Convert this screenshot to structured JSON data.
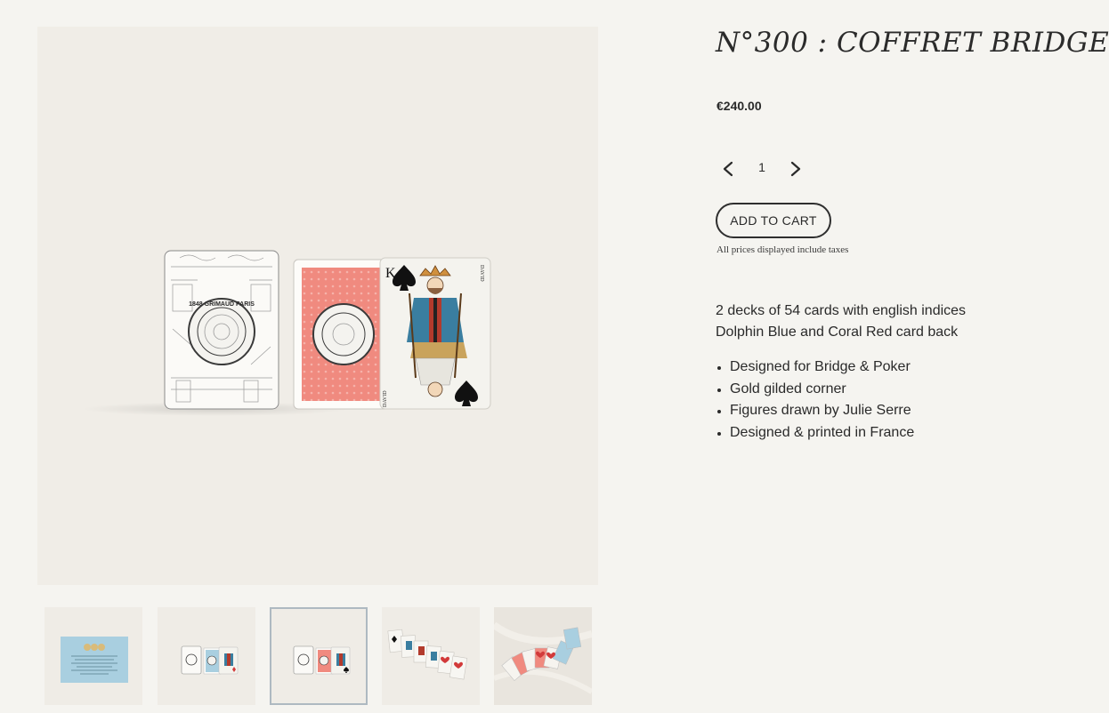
{
  "product": {
    "title": "N°300 : COFFRET BRIDGE",
    "price": "€240.00",
    "quantity": "1",
    "add_to_cart_label": "ADD TO CART",
    "tax_note": "All prices displayed include taxes"
  },
  "description": {
    "lines": [
      "2 decks of 54 cards with english indices",
      "Dolphin Blue and Coral Red card back"
    ],
    "features": [
      "Designed for Bridge & Poker",
      "Gold gilded corner",
      "Figures drawn by Julie Serre",
      "Designed & printed in France"
    ]
  },
  "gallery": {
    "seal_text": "1848 GRIMAUD PARIS",
    "card_name": "DAVID",
    "card_rank": "K",
    "selected_index": 2,
    "thumbnails": [
      {
        "content": "blue box lid"
      },
      {
        "content": "box with blue deck"
      },
      {
        "content": "box with coral deck"
      },
      {
        "content": "fanned cards"
      },
      {
        "content": "spread of cards"
      }
    ]
  },
  "colors": {
    "background": "#f5f4f0",
    "image_background": "#f0ede7",
    "coral": "#f08a7f",
    "dolphin_blue": "#a9cfe0",
    "selected_border": "#aeb9c1"
  },
  "icons": {
    "decrease": "chevron-left-icon",
    "increase": "chevron-right-icon"
  }
}
